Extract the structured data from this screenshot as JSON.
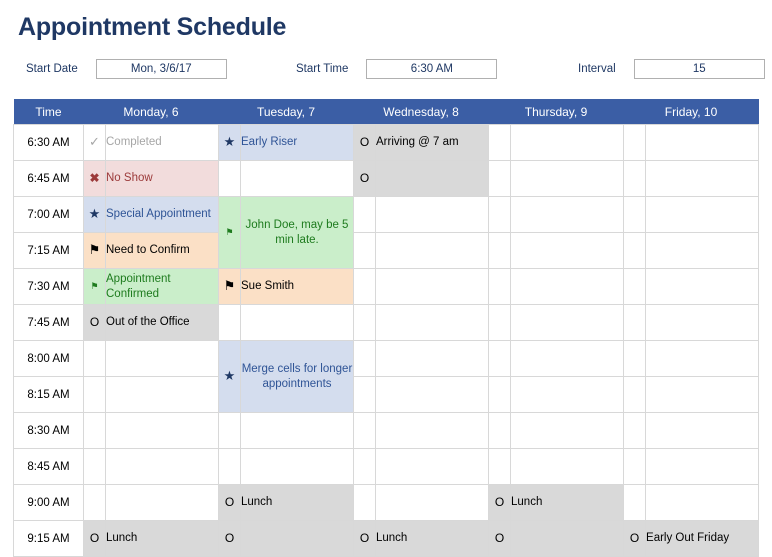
{
  "page": {
    "title": "Appointment Schedule",
    "accent_color": "#1F3864",
    "header_bar_color": "#3B5EA5"
  },
  "params": [
    {
      "label": "Start Date",
      "value": "Mon, 3/6/17"
    },
    {
      "label": "Start Time",
      "value": "6:30 AM"
    },
    {
      "label": "Interval",
      "value": "15"
    }
  ],
  "grid": {
    "columns": [
      "Time",
      "Monday, 6",
      "Tuesday, 7",
      "Wednesday, 8",
      "Thursday, 9",
      "Friday, 10"
    ],
    "times": [
      "6:30 AM",
      "6:45 AM",
      "7:00 AM",
      "7:15 AM",
      "7:30 AM",
      "7:45 AM",
      "8:00 AM",
      "8:15 AM",
      "8:30 AM",
      "8:45 AM",
      "9:00 AM",
      "9:15 AM"
    ],
    "entries": {
      "mon_0630_icon": "✓",
      "mon_0630_text": "Completed",
      "mon_0645_icon": "✖",
      "mon_0645_text": "No Show",
      "mon_0700_icon": "★",
      "mon_0700_text": "Special Appointment",
      "mon_0715_icon": "⚑",
      "mon_0715_text": "Need to Confirm",
      "mon_0730_icon": "⚑",
      "mon_0730_text": "Appointment Confirmed",
      "mon_0745_icon": "O",
      "mon_0745_text": "Out of the Office",
      "mon_0915_icon": "O",
      "mon_0915_text": "Lunch",
      "tue_0630_icon": "★",
      "tue_0630_text": "Early Riser",
      "tue_0700_icon": "⚑",
      "tue_0700_text": "John Doe, may be 5 min late.",
      "tue_0730_icon": "⚑",
      "tue_0730_text": "Sue Smith",
      "tue_0800_icon": "★",
      "tue_0800_text": "Merge cells for longer appointments",
      "tue_0900_icon": "O",
      "tue_0900_text": "Lunch",
      "tue_0915_icon": "O",
      "tue_0915_text": "",
      "wed_0630_icon": "O",
      "wed_0630_text": "Arriving @ 7 am",
      "wed_0645_icon": "O",
      "wed_0645_text": "",
      "wed_0915_icon": "O",
      "wed_0915_text": "Lunch",
      "thu_0900_icon": "O",
      "thu_0900_text": "Lunch",
      "thu_0915_icon": "O",
      "thu_0915_text": "",
      "fri_0915_icon": "O",
      "fri_0915_text": "Early Out Friday"
    }
  }
}
